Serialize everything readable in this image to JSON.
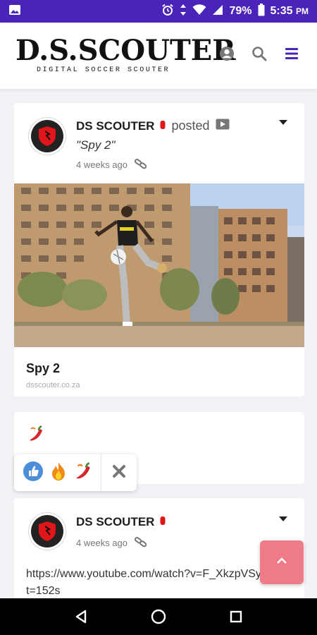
{
  "status_bar": {
    "battery_percent": "79%",
    "time": "5:35",
    "time_suffix": "PM",
    "icons": [
      "image-notification-icon",
      "alarm-icon",
      "data-arrows-icon",
      "wifi-icon",
      "signal-icon",
      "battery-icon"
    ]
  },
  "header": {
    "logo_main": "D.S.SCOUTER",
    "logo_sub": "DIGITAL SOCCER SCOUTER",
    "icons": [
      "user-account-icon",
      "search-icon",
      "hamburger-menu-icon"
    ],
    "accent_color": "#4a24b8"
  },
  "post1": {
    "author": "DS SCOUTER",
    "action": "posted",
    "quote": "\"Spy 2\"",
    "time": "4 weeks ago",
    "link_title": "Spy 2",
    "link_domain": "dsscouter.co.za"
  },
  "reactions": {
    "count_emoji": "chili-pepper",
    "picker": [
      "like-thumbs-up",
      "fire",
      "chili-pepper"
    ]
  },
  "post2": {
    "author": "DS SCOUTER",
    "time": "4 weeks ago",
    "text": "https://www.youtube.com/watch?v=F_XkzpVSylY&t=152s"
  },
  "fab": {
    "icon": "chevron-up-icon",
    "color": "#ef7a88"
  },
  "nav": {
    "icons": [
      "back-icon",
      "home-icon",
      "recents-icon"
    ]
  }
}
